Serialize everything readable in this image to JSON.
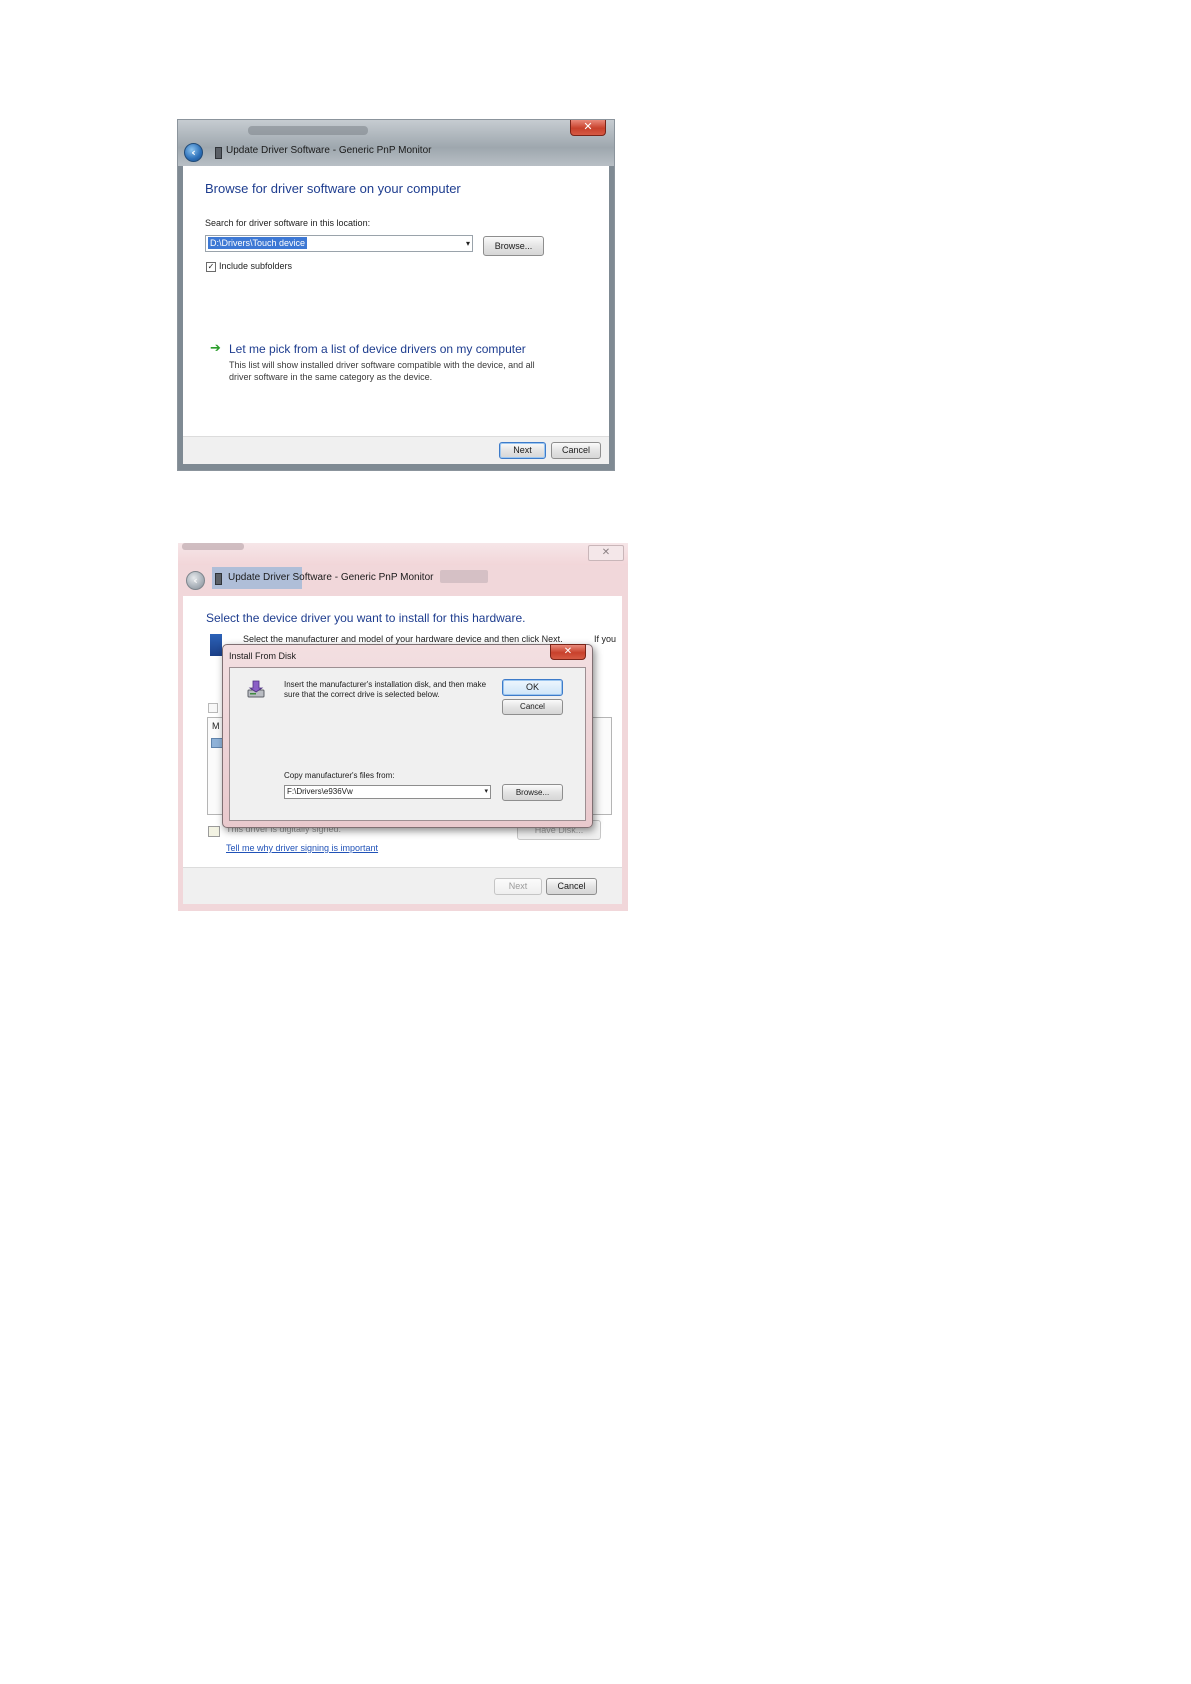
{
  "shot1": {
    "window_title": "Update Driver Software - Generic PnP Monitor",
    "close_glyph": "✕",
    "back_glyph": "‹",
    "heading": "Browse for driver software on your computer",
    "location_label": "Search for driver software in this location:",
    "path_value": "D:\\Drivers\\Touch device",
    "combo_arrow": "▾",
    "browse_label": "Browse...",
    "include_subfolders": {
      "label": "Include subfolders",
      "checked": true,
      "glyph": "✓"
    },
    "pick_arrow": "➔",
    "pick_title": "Let me pick from a list of device drivers on my computer",
    "pick_description": "This list will show installed driver software compatible with the device, and all driver software in the same category as the device.",
    "next_label": "Next",
    "cancel_label": "Cancel",
    "icons": [
      "back-arrow-icon",
      "device-icon",
      "close-icon",
      "green-arrow-icon"
    ]
  },
  "shot2": {
    "window_title": "Update Driver Software - Generic PnP Monitor",
    "close_glyph": "✕",
    "back_glyph": "‹",
    "heading": "Select the device driver you want to install for this hardware.",
    "instruction_visible": "Select the manufacturer and model of your hardware device and then click Next.",
    "instruction_end": "If you",
    "list_letter": "M",
    "signed_text": "This driver is digitally signed.",
    "have_disk_label": "Have Disk...",
    "signing_link": "Tell me why driver signing is important",
    "next_label": "Next",
    "cancel_label": "Cancel",
    "install_from_disk": {
      "title": "Install From Disk",
      "close_glyph": "✕",
      "message": "Insert the manufacturer's installation disk, and then make sure that the correct drive is selected below.",
      "ok_label": "OK",
      "cancel_label": "Cancel",
      "copy_label": "Copy manufacturer's files from:",
      "copy_value": "F:\\Drivers\\e936Vw",
      "combo_arrow": "▾",
      "browse_label": "Browse..."
    },
    "icons": [
      "back-arrow-icon",
      "device-icon",
      "close-icon",
      "disk-drive-icon",
      "certificate-icon"
    ]
  },
  "colors": {
    "heading_blue": "#1e3d8f",
    "link_blue": "#2052b8",
    "close_red": "#c8412c",
    "selection_blue": "#3d78d4",
    "aero_pink": "#f1d7da"
  }
}
